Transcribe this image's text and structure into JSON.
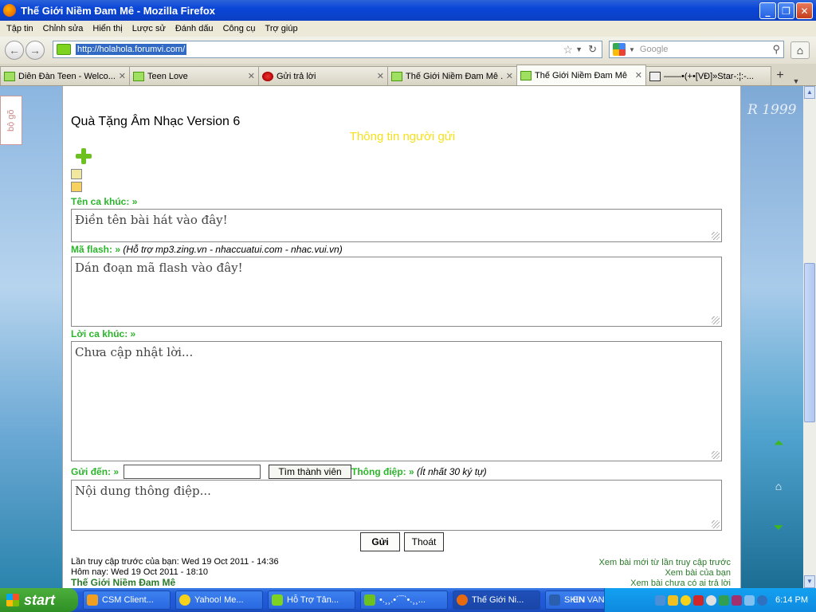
{
  "window": {
    "title": "Thế Giới Niềm Đam Mê - Mozilla Firefox"
  },
  "menu": [
    "Tập tin",
    "Chỉnh sửa",
    "Hiển thị",
    "Lược sử",
    "Đánh dấu",
    "Công cụ",
    "Trợ giúp"
  ],
  "nav": {
    "url": "http://holahola.forumvi.com/",
    "search_placeholder": "Google"
  },
  "tabs": [
    {
      "label": "Diễn Đàn Teen - Welco...",
      "icon": "green"
    },
    {
      "label": "Teen Love",
      "icon": "green"
    },
    {
      "label": "Gửi trả lời",
      "icon": "red"
    },
    {
      "label": "Thế Giới Niềm Đam Mê ...",
      "icon": "green"
    },
    {
      "label": "Thế Giới Niềm Đam Mê",
      "icon": "green",
      "active": true
    },
    {
      "label": "——•(+•[VĐ]»Star-:¦:-...",
      "icon": "vd"
    }
  ],
  "side": {
    "left_badge": "bộ gõ",
    "right_mark": "R 1999"
  },
  "form": {
    "title": "Quà Tặng Âm Nhạc Version 6",
    "sender_heading": "Thông tin người gửi",
    "song_label": "Tên ca khúc: »",
    "song_value": "Điền tên bài hát vào đây!",
    "flash_label": "Mã flash: »",
    "flash_note": "(Hỗ trợ mp3.zing.vn - nhaccuatui.com - nhac.vui.vn)",
    "flash_value": "Dán đoạn mã flash vào đây!",
    "lyrics_label": "Lời ca khúc: »",
    "lyrics_value": "Chưa cập nhật lời...",
    "to_label": "Gửi đến: »",
    "to_value": "",
    "find_button": "Tìm thành viên",
    "message_label": "Thông điệp: »",
    "message_note": "(Ít nhất 30 ký tự)",
    "message_value": "Nội dung thông điệp...",
    "send_button": "Gửi",
    "exit_button": "Thoát"
  },
  "footer": {
    "last_visit": "Lần truy cập trước của bạn: Wed 19 Oct 2011 - 14:36",
    "today": "Hôm nay: Wed 19 Oct 2011 - 18:10",
    "forum_name": "Thế Giới Niềm Đam Mê",
    "link_new": "Xem bài mới từ lần truy cập trước",
    "link_mine": "Xem bài của bạn",
    "link_unanswered": "Xem bài chưa có ai trả lời"
  },
  "taskbar": {
    "start": "start",
    "items": [
      {
        "label": "CSM Client...",
        "color": "#f0a020"
      },
      {
        "label": "Yahoo! Me...",
        "color": "#f7d21a"
      },
      {
        "label": "Hỗ Trợ Tân...",
        "color": "#7ed321"
      },
      {
        "label": "•.¸¸.•´¯`•.¸¸...",
        "color": "#6cc020"
      },
      {
        "label": "Thế Giới Ni...",
        "color": "#e86a10",
        "active": true
      },
      {
        "label": "SKIN VAND...",
        "color": "#2a5fb0"
      }
    ],
    "lang": "EN",
    "clock": "6:14 PM"
  }
}
